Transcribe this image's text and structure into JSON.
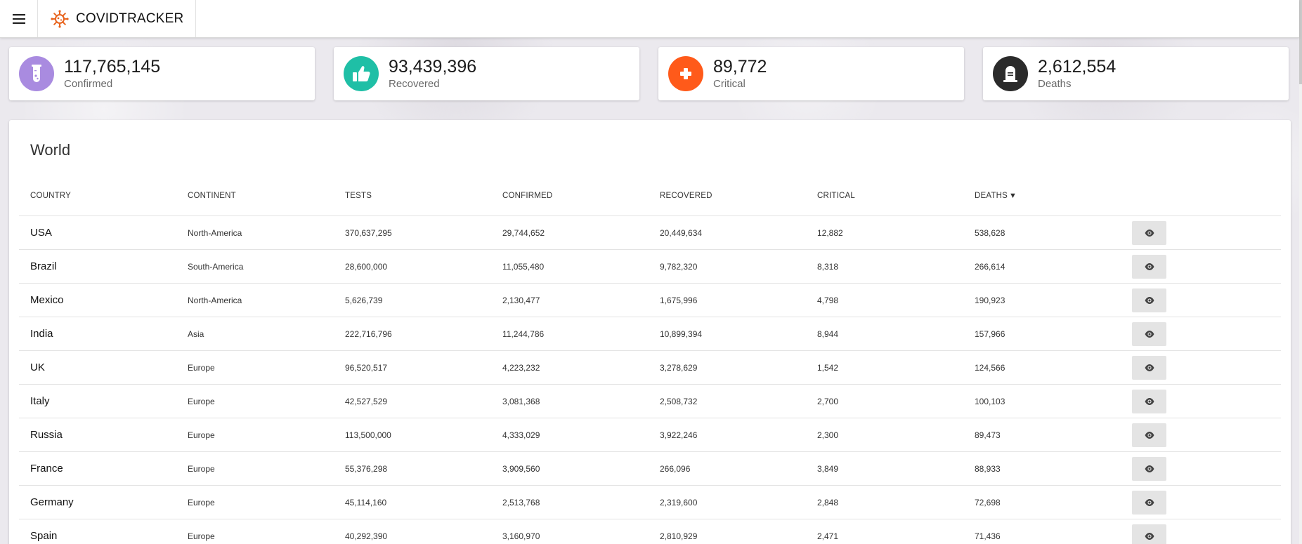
{
  "header": {
    "brand_name": "COVIDTRACKER",
    "menu_icon": "hamburger-menu-icon",
    "logo_icon": "virus-icon",
    "logo_color": "#e8641e"
  },
  "stats": [
    {
      "key": "confirmed",
      "value": "117,765,145",
      "label": "Confirmed",
      "icon": "test-tube-icon",
      "color": "#a98be0"
    },
    {
      "key": "recovered",
      "value": "93,439,396",
      "label": "Recovered",
      "icon": "thumbs-up-icon",
      "color": "#1fbfa6"
    },
    {
      "key": "critical",
      "value": "89,772",
      "label": "Critical",
      "icon": "medical-cross-icon",
      "color": "#ff5a1a"
    },
    {
      "key": "deaths",
      "value": "2,612,554",
      "label": "Deaths",
      "icon": "tombstone-icon",
      "color": "#2b2b2b"
    }
  ],
  "table": {
    "title": "World",
    "columns": [
      "COUNTRY",
      "CONTINENT",
      "TESTS",
      "CONFIRMED",
      "RECOVERED",
      "CRITICAL",
      "DEATHS"
    ],
    "sorted_column": "DEATHS",
    "sort_direction": "desc",
    "rows": [
      {
        "country": "USA",
        "continent": "North-America",
        "tests": "370,637,295",
        "confirmed": "29,744,652",
        "recovered": "20,449,634",
        "critical": "12,882",
        "deaths": "538,628"
      },
      {
        "country": "Brazil",
        "continent": "South-America",
        "tests": "28,600,000",
        "confirmed": "11,055,480",
        "recovered": "9,782,320",
        "critical": "8,318",
        "deaths": "266,614"
      },
      {
        "country": "Mexico",
        "continent": "North-America",
        "tests": "5,626,739",
        "confirmed": "2,130,477",
        "recovered": "1,675,996",
        "critical": "4,798",
        "deaths": "190,923"
      },
      {
        "country": "India",
        "continent": "Asia",
        "tests": "222,716,796",
        "confirmed": "11,244,786",
        "recovered": "10,899,394",
        "critical": "8,944",
        "deaths": "157,966"
      },
      {
        "country": "UK",
        "continent": "Europe",
        "tests": "96,520,517",
        "confirmed": "4,223,232",
        "recovered": "3,278,629",
        "critical": "1,542",
        "deaths": "124,566"
      },
      {
        "country": "Italy",
        "continent": "Europe",
        "tests": "42,527,529",
        "confirmed": "3,081,368",
        "recovered": "2,508,732",
        "critical": "2,700",
        "deaths": "100,103"
      },
      {
        "country": "Russia",
        "continent": "Europe",
        "tests": "113,500,000",
        "confirmed": "4,333,029",
        "recovered": "3,922,246",
        "critical": "2,300",
        "deaths": "89,473"
      },
      {
        "country": "France",
        "continent": "Europe",
        "tests": "55,376,298",
        "confirmed": "3,909,560",
        "recovered": "266,096",
        "critical": "3,849",
        "deaths": "88,933"
      },
      {
        "country": "Germany",
        "continent": "Europe",
        "tests": "45,114,160",
        "confirmed": "2,513,768",
        "recovered": "2,319,600",
        "critical": "2,848",
        "deaths": "72,698"
      },
      {
        "country": "Spain",
        "continent": "Europe",
        "tests": "40,292,390",
        "confirmed": "3,160,970",
        "recovered": "2,810,929",
        "critical": "2,471",
        "deaths": "71,436"
      }
    ],
    "row_action_icon": "eye-icon"
  }
}
